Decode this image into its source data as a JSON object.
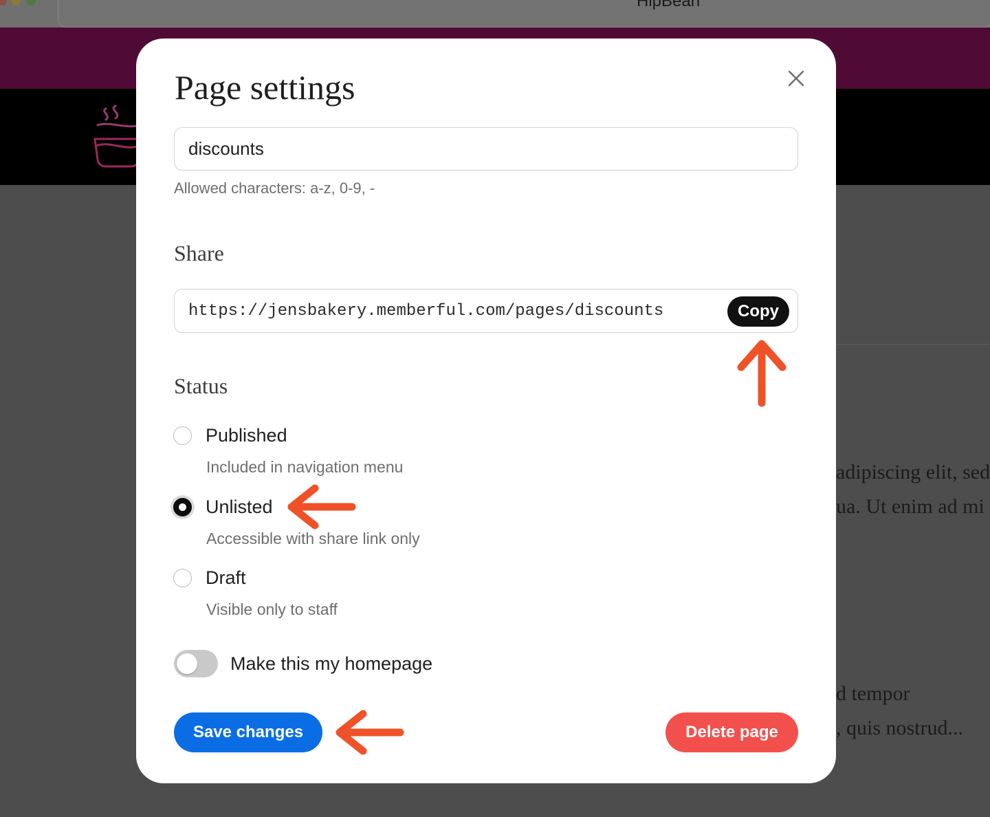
{
  "window": {
    "title": "HipBean"
  },
  "modal": {
    "title": "Page settings",
    "slug": {
      "value": "discounts",
      "helper": "Allowed characters: a-z, 0-9, -"
    },
    "share": {
      "heading": "Share",
      "url": "https://jensbakery.memberful.com/pages/discounts",
      "copy_label": "Copy"
    },
    "status": {
      "heading": "Status",
      "selected": "Unlisted",
      "options": [
        {
          "label": "Published",
          "description": "Included in navigation menu",
          "checked": false
        },
        {
          "label": "Unlisted",
          "description": "Accessible with share link only",
          "checked": true
        },
        {
          "label": "Draft",
          "description": "Visible only to staff",
          "checked": false
        }
      ]
    },
    "homepage_toggle": {
      "label": "Make this my homepage",
      "on": false
    },
    "save_label": "Save changes",
    "delete_label": "Delete page"
  },
  "background_text": [
    "adipiscing elit, sed",
    "ua. Ut enim ad mi",
    "d tempor",
    ", quis nostrud..."
  ],
  "colors": {
    "brand_bar": "#4f0b35",
    "primary": "#0b6de3",
    "danger": "#f2504c",
    "annotation_arrow": "#ef5229"
  }
}
